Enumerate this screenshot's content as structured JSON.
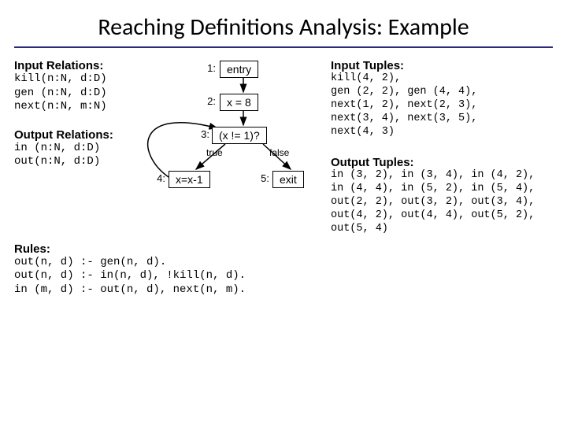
{
  "title": "Reaching Definitions Analysis: Example",
  "input_relations": {
    "heading": "Input Relations:",
    "lines": "kill(n:N, d:D)\ngen (n:N, d:D)\nnext(n:N, m:N)"
  },
  "output_relations": {
    "heading": "Output Relations:",
    "lines": "in (n:N, d:D)\nout(n:N, d:D)"
  },
  "cfg": {
    "nodes": {
      "n1": {
        "num": "1:",
        "label": "entry"
      },
      "n2": {
        "num": "2:",
        "label": "x = 8"
      },
      "n3": {
        "num": "3:",
        "label": "(x != 1)?"
      },
      "n4": {
        "num": "4:",
        "label": "x=x-1"
      },
      "n5": {
        "num": "5:",
        "label": "exit"
      }
    },
    "edge_labels": {
      "true": "true",
      "false": "false"
    }
  },
  "rules": {
    "heading": "Rules:",
    "lines": "out(n, d) :- gen(n, d).\nout(n, d) :- in(n, d), !kill(n, d).\nin (m, d) :- out(n, d), next(n, m)."
  },
  "input_tuples": {
    "heading": "Input Tuples:",
    "lines": "kill(4, 2),\ngen (2, 2), gen (4, 4),\nnext(1, 2), next(2, 3),\nnext(3, 4), next(3, 5),\nnext(4, 3)"
  },
  "output_tuples": {
    "heading": "Output Tuples:",
    "lines": "in (3, 2), in (3, 4), in (4, 2),\nin (4, 4), in (5, 2), in (5, 4),\nout(2, 2), out(3, 2), out(3, 4),\nout(4, 2), out(4, 4), out(5, 2),\nout(5, 4)"
  },
  "chart_data": {
    "type": "diagram",
    "title": "Control-flow graph for reaching-definitions example",
    "nodes": [
      {
        "id": 1,
        "label": "entry"
      },
      {
        "id": 2,
        "label": "x = 8"
      },
      {
        "id": 3,
        "label": "(x != 1)?"
      },
      {
        "id": 4,
        "label": "x = x - 1"
      },
      {
        "id": 5,
        "label": "exit"
      }
    ],
    "edges": [
      {
        "from": 1,
        "to": 2
      },
      {
        "from": 2,
        "to": 3
      },
      {
        "from": 3,
        "to": 4,
        "label": "true"
      },
      {
        "from": 3,
        "to": 5,
        "label": "false"
      },
      {
        "from": 4,
        "to": 3
      }
    ]
  }
}
